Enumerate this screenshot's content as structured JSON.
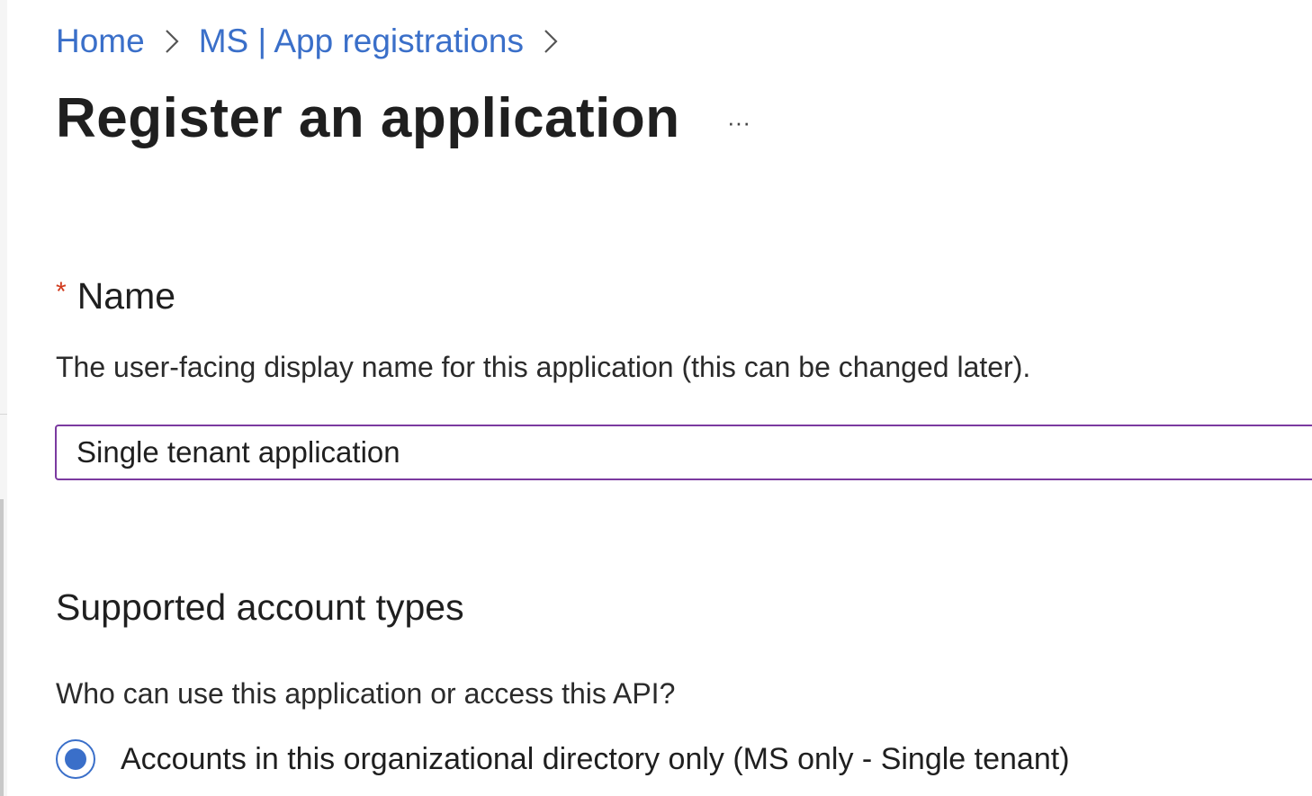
{
  "breadcrumb": {
    "items": [
      "Home",
      "MS | App registrations"
    ]
  },
  "page": {
    "title": "Register an application",
    "more_label": "···"
  },
  "name_field": {
    "required_marker": "*",
    "label": "Name",
    "description": "The user-facing display name for this application (this can be changed later).",
    "value": "Single tenant application"
  },
  "account_types": {
    "title": "Supported account types",
    "question": "Who can use this application or access this API?",
    "options": [
      {
        "label": "Accounts in this organizational directory only (MS only - Single tenant)",
        "selected": true
      }
    ]
  },
  "colors": {
    "link": "#3a6fc9",
    "required": "#d13a1d",
    "input_border": "#7b3aa0",
    "radio": "#3a6fc9"
  },
  "icons": [
    "chevron-right-icon",
    "more-icon",
    "radio-selected-icon"
  ]
}
